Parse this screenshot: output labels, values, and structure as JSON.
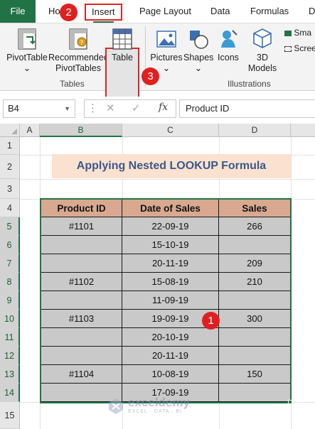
{
  "ribbon_tabs": {
    "file": "File",
    "home": "Ho",
    "insert": "Insert",
    "page_layout": "Page Layout",
    "data": "Data",
    "formulas": "Formulas",
    "review": "D"
  },
  "ribbon_buttons": {
    "pivot_table": "PivotTable",
    "recommended_1": "Recommended",
    "recommended_2": "PivotTables",
    "table": "Table",
    "pictures": "Pictures",
    "shapes": "Shapes",
    "icons": "Icons",
    "models_1": "3D",
    "models_2": "Models",
    "smartart": "Sma",
    "screenshot": "Scree",
    "chevron": "⌄"
  },
  "group_labels": {
    "tables": "Tables",
    "illustrations": "Illustrations"
  },
  "badges": {
    "insert": "2",
    "table": "3",
    "cell": "1"
  },
  "formula_bar": {
    "name_box": "B4",
    "fx": "fx",
    "cancel": "✕",
    "enter": "✓",
    "formula": "Product ID"
  },
  "columns": [
    "A",
    "B",
    "C",
    "D"
  ],
  "rows": [
    "1",
    "2",
    "3",
    "4",
    "5",
    "6",
    "7",
    "8",
    "9",
    "10",
    "11",
    "12",
    "13",
    "14",
    "15"
  ],
  "sheet_title": "Applying Nested LOOKUP Formula",
  "table": {
    "headers": [
      "Product ID",
      "Date of Sales",
      "Sales"
    ],
    "rows": [
      [
        "#1101",
        "22-09-19",
        "266"
      ],
      [
        "",
        "15-10-19",
        ""
      ],
      [
        "",
        "20-11-19",
        "209"
      ],
      [
        "#1102",
        "15-08-19",
        "210"
      ],
      [
        "",
        "11-09-19",
        ""
      ],
      [
        "#1103",
        "19-09-19",
        "300"
      ],
      [
        "",
        "20-10-19",
        ""
      ],
      [
        "",
        "20-11-19",
        ""
      ],
      [
        "#1104",
        "10-08-19",
        "150"
      ],
      [
        "",
        "17-09-19",
        ""
      ]
    ]
  },
  "watermark": {
    "name": "exceldemy",
    "tagline": "EXCEL · DATA · BI"
  },
  "colors": {
    "excel_green": "#217346",
    "highlight_red": "#e02424",
    "title_fill": "#fbe1d0",
    "header_fill": "#d8a990",
    "body_fill": "#c9c9c9"
  }
}
